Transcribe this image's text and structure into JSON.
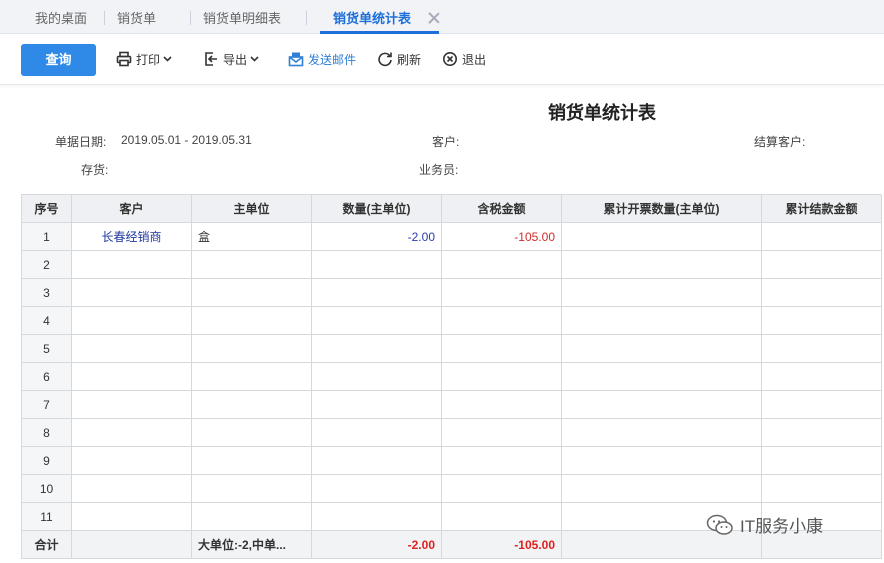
{
  "tabs": [
    {
      "label": "我的桌面"
    },
    {
      "label": "销货单"
    },
    {
      "label": "销货单明细表"
    },
    {
      "label": "销货单统计表"
    }
  ],
  "toolbar": {
    "query": "查询",
    "print": "打印",
    "export": "导出",
    "mail": "发送邮件",
    "refresh": "刷新",
    "exit": "退出"
  },
  "report": {
    "title": "销货单统计表",
    "date_label": "单据日期:",
    "date_value": "2019.05.01 - 2019.05.31",
    "customer_label": "客户:",
    "settle_label": "结算客户:",
    "stock_label": "存货:",
    "sales_label": "业务员:"
  },
  "table": {
    "headers": [
      "序号",
      "客户",
      "主单位",
      "数量(主单位)",
      "含税金额",
      "累计开票数量(主单位)",
      "累计结款金额"
    ],
    "rows": [
      {
        "idx": "1",
        "customer": "长春经销商",
        "unit": "盒",
        "qty": "-2.00",
        "amount": "-105.00"
      },
      {
        "idx": "2"
      },
      {
        "idx": "3"
      },
      {
        "idx": "4"
      },
      {
        "idx": "5"
      },
      {
        "idx": "6"
      },
      {
        "idx": "7"
      },
      {
        "idx": "8"
      },
      {
        "idx": "9"
      },
      {
        "idx": "10"
      },
      {
        "idx": "11"
      }
    ],
    "total": {
      "label": "合计",
      "unit": "大单位:-2,中单...",
      "qty": "-2.00",
      "amount": "-105.00"
    }
  },
  "watermark": {
    "text": "IT服务小康"
  },
  "colors": {
    "accent": "#2e8ae6",
    "negative": "#e0201f",
    "link": "#1f3a9c"
  }
}
